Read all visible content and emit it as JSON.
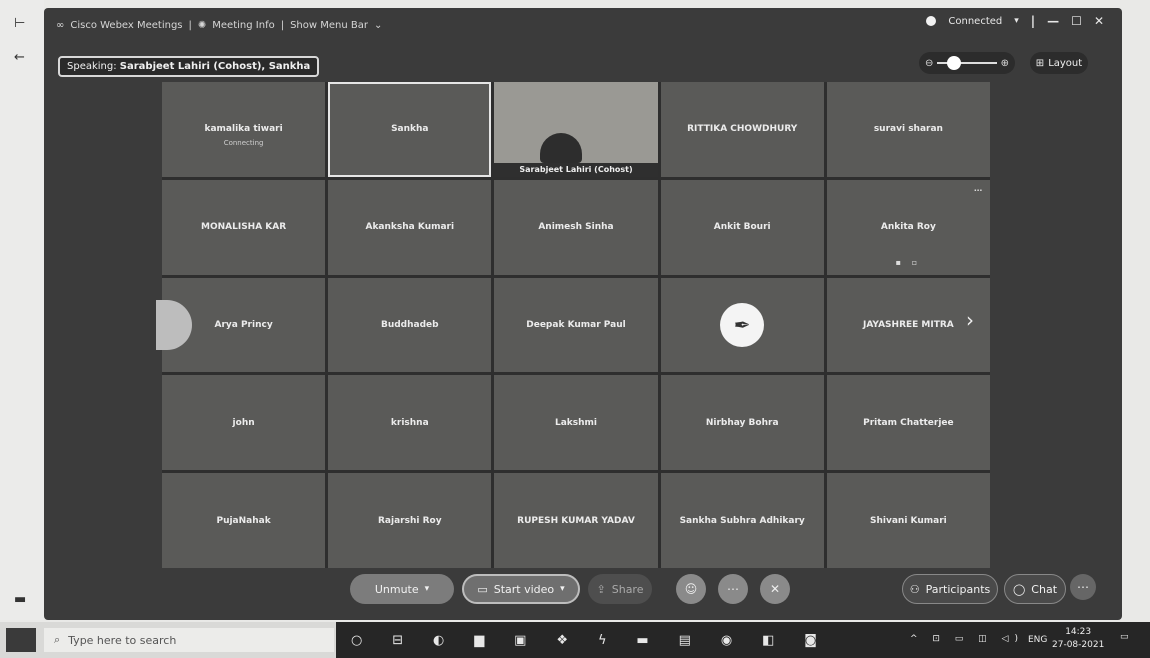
{
  "window": {
    "app_title": "Cisco Webex Meetings",
    "meeting_info": "Meeting Info",
    "show_menu_bar": "Show Menu Bar",
    "status": "Connected",
    "controls": {
      "minimize": "—",
      "maximize": "☐",
      "close": "✕"
    }
  },
  "speaking": {
    "label": "Speaking:",
    "names": "Sarabjeet Lahiri (Cohost), Sankha"
  },
  "layout_button": "Layout",
  "participants_grid": [
    {
      "name": "kamalika tiwari",
      "sub": "Connecting"
    },
    {
      "name": "Sankha",
      "active": true
    },
    {
      "name": "Sarabjeet Lahiri (Cohost)",
      "video": true
    },
    {
      "name": "RITTIKA CHOWDHURY"
    },
    {
      "name": "suravi sharan"
    },
    {
      "name": "MONALISHA KAR"
    },
    {
      "name": "Akanksha Kumari"
    },
    {
      "name": "Animesh Sinha"
    },
    {
      "name": "Ankit Bouri"
    },
    {
      "name": "Ankita Roy"
    },
    {
      "name": "Arya Princy"
    },
    {
      "name": "Buddhadeb"
    },
    {
      "name": "Deepak Kumar Paul"
    },
    {
      "name": "",
      "logo": true
    },
    {
      "name": "JAYASHREE MITRA"
    },
    {
      "name": "john"
    },
    {
      "name": "krishna"
    },
    {
      "name": "Lakshmi"
    },
    {
      "name": "Nirbhay Bohra"
    },
    {
      "name": "Pritam Chatterjee"
    },
    {
      "name": "PujaNahak"
    },
    {
      "name": "Rajarshi Roy"
    },
    {
      "name": "RUPESH KUMAR YADAV"
    },
    {
      "name": "Sankha Subhra Adhikary"
    },
    {
      "name": "Shivani Kumari"
    }
  ],
  "controls": {
    "unmute": "Unmute",
    "start_video": "Start video",
    "share": "Share",
    "participants": "Participants",
    "chat": "Chat"
  },
  "taskbar": {
    "search_placeholder": "Type here to search",
    "lang": "ENG",
    "time": "14:23",
    "date": "27-08-2021"
  }
}
